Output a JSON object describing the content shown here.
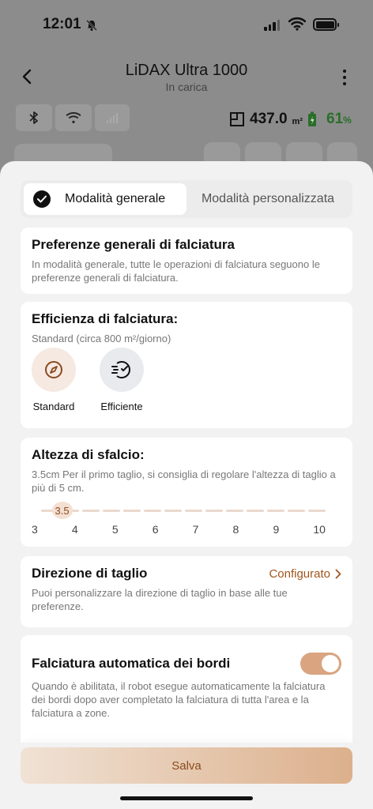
{
  "status": {
    "time": "12:01"
  },
  "header": {
    "title": "LiDAX Ultra 1000",
    "subtitle": "In carica"
  },
  "stats": {
    "area_value": "437.0",
    "area_unit": "m²",
    "battery_pct": "61",
    "battery_pct_unit": "%"
  },
  "tabs": {
    "active_label": "Modalità generale",
    "inactive_label": "Modalità personalizzata"
  },
  "prefs": {
    "title": "Preferenze generali di falciatura",
    "description": "In modalità generale, tutte le operazioni di falciatura seguono le preferenze generali di falciatura."
  },
  "efficiency": {
    "title": "Efficienza di falciatura:",
    "description": "Standard (circa 800 m²/giorno)",
    "options": [
      {
        "label": "Standard",
        "icon": "compass-icon",
        "selected": true
      },
      {
        "label": "Efficiente",
        "icon": "speed-icon",
        "selected": false
      }
    ]
  },
  "height": {
    "title": "Altezza di sfalcio:",
    "description": "3.5cm Per il primo taglio, si consiglia di regolare l'altezza di taglio a più di 5 cm.",
    "value": "3.5",
    "min": 3,
    "max": 10,
    "ticks": [
      "3",
      "4",
      "5",
      "6",
      "7",
      "8",
      "9",
      "10"
    ]
  },
  "direction": {
    "title": "Direzione di taglio",
    "link": "Configurato",
    "description": "Puoi personalizzare la direzione di taglio in base alle tue preferenze."
  },
  "edge": {
    "title": "Falciatura automatica dei bordi",
    "enabled": true,
    "description": "Quando è abilitata, il robot esegue automaticamente la falciatura dei bordi dopo aver completato la falciatura di tutta l'area e la falciatura a zone."
  },
  "actions": {
    "save_label": "Salva"
  },
  "colors": {
    "accent": "#a0551b",
    "toggle_on": "#d9a47f",
    "sheet_bg": "#f3f2f2"
  }
}
